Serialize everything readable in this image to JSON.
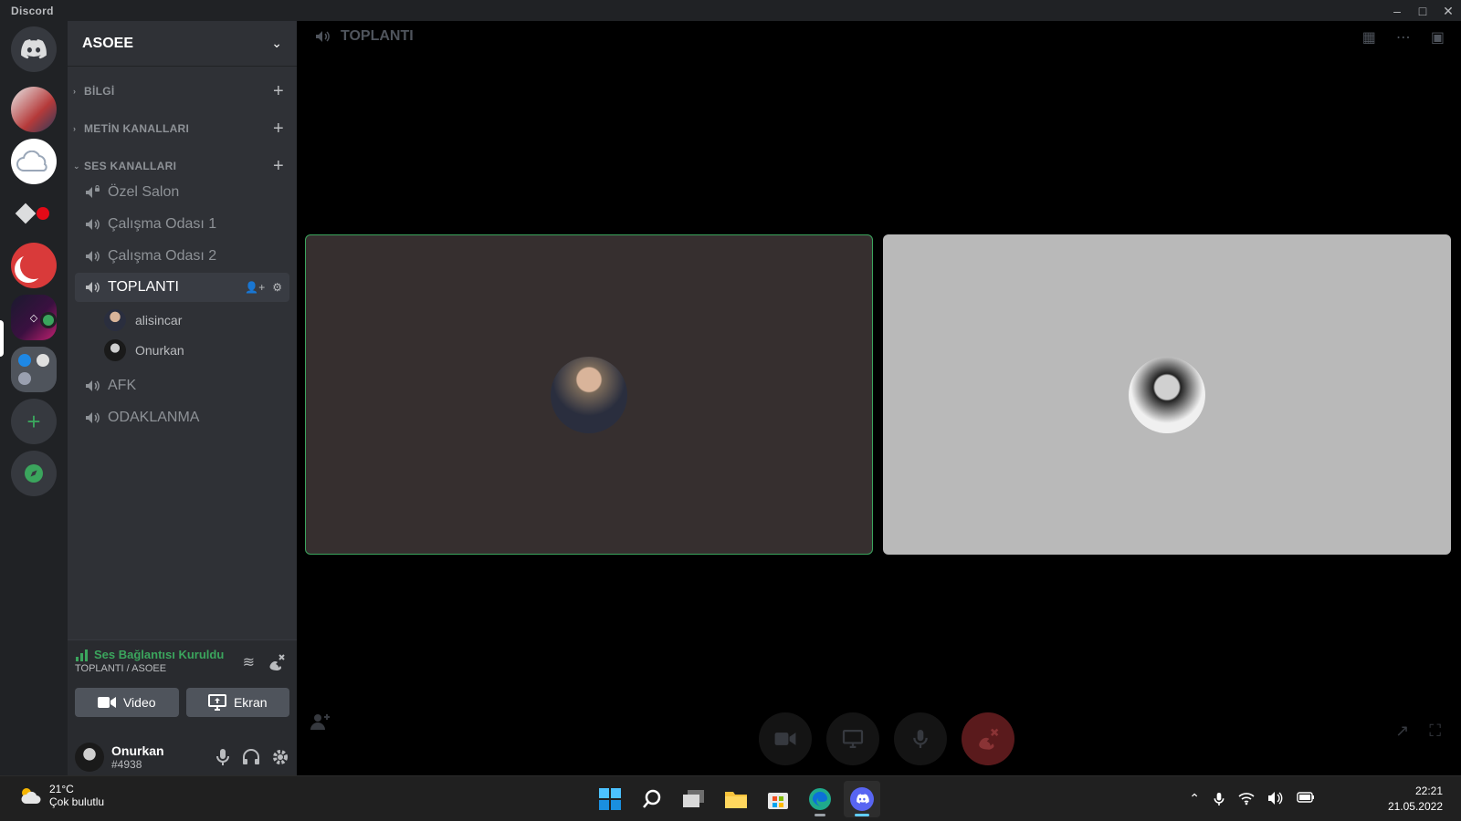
{
  "window": {
    "app_name": "Discord",
    "controls": [
      "minimize",
      "maximize",
      "close"
    ]
  },
  "guilds": {
    "items": [
      {
        "name": "home",
        "icon": "discord-logo-icon"
      },
      {
        "name": "server-1"
      },
      {
        "name": "server-2"
      },
      {
        "name": "server-3"
      },
      {
        "name": "server-4"
      },
      {
        "name": "ASOEE",
        "selected": true
      },
      {
        "name": "server-6"
      }
    ],
    "add_icon": "plus-icon",
    "explore_icon": "compass-icon",
    "accent": "#3ba55d"
  },
  "server": {
    "name": "ASOEE"
  },
  "categories": [
    {
      "label": "BİLGİ",
      "collapsed": true
    },
    {
      "label": "METİN KANALLARI",
      "collapsed": true
    },
    {
      "label": "SES KANALLARI",
      "collapsed": false
    }
  ],
  "voice_channels": [
    {
      "label": "Özel Salon",
      "locked": true
    },
    {
      "label": "Çalışma Odası 1"
    },
    {
      "label": "Çalışma Odası 2"
    },
    {
      "label": "TOPLANTI",
      "active": true
    },
    {
      "label": "AFK"
    },
    {
      "label": "ODAKLANMA"
    }
  ],
  "voice_members": [
    {
      "name": "alisincar"
    },
    {
      "name": "Onurkan"
    }
  ],
  "rtc": {
    "status": "Ses Bağlantısı Kuruldu",
    "location": "TOPLANTI / ASOEE",
    "video_label": "Video",
    "screen_label": "Ekran"
  },
  "user": {
    "name": "Onurkan",
    "tag": "#4938"
  },
  "stage": {
    "title": "TOPLANTI",
    "tiles": [
      {
        "user": "alisincar",
        "speaking": true,
        "bg": "#362f2f"
      },
      {
        "user": "Onurkan",
        "speaking": false,
        "bg": "#b9b9b9"
      }
    ],
    "controls": [
      "camera-icon",
      "screen-share-icon",
      "mic-icon",
      "disconnect-icon"
    ],
    "end_color": "#ed4245"
  },
  "taskbar": {
    "weather_temp": "21°C",
    "weather_desc": "Çok bulutlu",
    "apps": [
      "windows-start-icon",
      "search-icon",
      "task-view-icon",
      "file-explorer-icon",
      "microsoft-store-icon",
      "edge-icon",
      "discord-icon"
    ],
    "time": "22:21",
    "date": "21.05.2022"
  }
}
